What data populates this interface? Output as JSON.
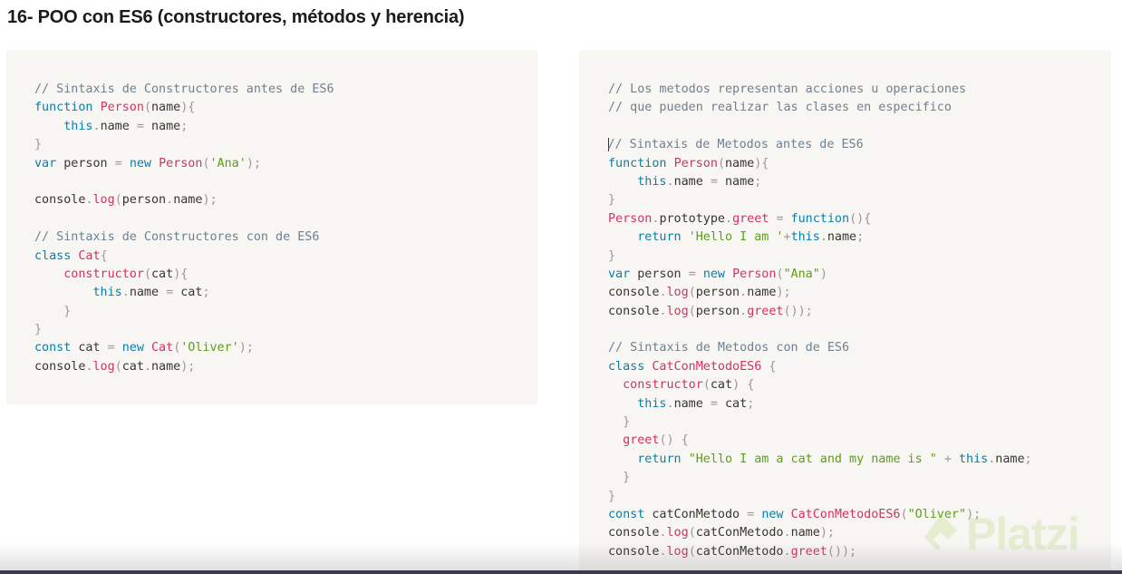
{
  "page": {
    "title": "16- POO con ES6 (constructores, métodos y herencia)"
  },
  "watermark": {
    "text": "Platzi"
  },
  "colors": {
    "panel_background": "#f7f6f3",
    "comment": "#708090",
    "keyword": "#0a7ea8",
    "function": "#d3325f",
    "string": "#5c9e17",
    "punctuation": "#999999",
    "watermark": "#98ca3f"
  },
  "code_blocks": [
    {
      "lines": [
        [
          [
            "comment",
            "// Sintaxis de Constructores antes de ES6"
          ]
        ],
        [
          [
            "keyword",
            "function"
          ],
          [
            "plain",
            " "
          ],
          [
            "function",
            "Person"
          ],
          [
            "punct",
            "("
          ],
          [
            "plain",
            "name"
          ],
          [
            "punct",
            "){"
          ]
        ],
        [
          [
            "plain",
            "    "
          ],
          [
            "keyword",
            "this"
          ],
          [
            "punct",
            "."
          ],
          [
            "plain",
            "name "
          ],
          [
            "punct",
            "="
          ],
          [
            "plain",
            " name"
          ],
          [
            "punct",
            ";"
          ]
        ],
        [
          [
            "punct",
            "}"
          ]
        ],
        [
          [
            "keyword",
            "var"
          ],
          [
            "plain",
            " person "
          ],
          [
            "punct",
            "="
          ],
          [
            "plain",
            " "
          ],
          [
            "keyword",
            "new"
          ],
          [
            "plain",
            " "
          ],
          [
            "function",
            "Person"
          ],
          [
            "punct",
            "("
          ],
          [
            "string",
            "'Ana'"
          ],
          [
            "punct",
            ");"
          ]
        ],
        [],
        [
          [
            "plain",
            "console"
          ],
          [
            "punct",
            "."
          ],
          [
            "function",
            "log"
          ],
          [
            "punct",
            "("
          ],
          [
            "plain",
            "person"
          ],
          [
            "punct",
            "."
          ],
          [
            "plain",
            "name"
          ],
          [
            "punct",
            ");"
          ]
        ],
        [],
        [
          [
            "comment",
            "// Sintaxis de Constructores con de ES6"
          ]
        ],
        [
          [
            "keyword",
            "class"
          ],
          [
            "plain",
            " "
          ],
          [
            "function",
            "Cat"
          ],
          [
            "punct",
            "{"
          ]
        ],
        [
          [
            "plain",
            "    "
          ],
          [
            "function",
            "constructor"
          ],
          [
            "punct",
            "("
          ],
          [
            "plain",
            "cat"
          ],
          [
            "punct",
            "){"
          ]
        ],
        [
          [
            "plain",
            "        "
          ],
          [
            "keyword",
            "this"
          ],
          [
            "punct",
            "."
          ],
          [
            "plain",
            "name "
          ],
          [
            "punct",
            "="
          ],
          [
            "plain",
            " cat"
          ],
          [
            "punct",
            ";"
          ]
        ],
        [
          [
            "plain",
            "    "
          ],
          [
            "punct",
            "}"
          ]
        ],
        [
          [
            "punct",
            "}"
          ]
        ],
        [
          [
            "keyword",
            "const"
          ],
          [
            "plain",
            " cat "
          ],
          [
            "punct",
            "="
          ],
          [
            "plain",
            " "
          ],
          [
            "keyword",
            "new"
          ],
          [
            "plain",
            " "
          ],
          [
            "function",
            "Cat"
          ],
          [
            "punct",
            "("
          ],
          [
            "string",
            "'Oliver'"
          ],
          [
            "punct",
            ");"
          ]
        ],
        [
          [
            "plain",
            "console"
          ],
          [
            "punct",
            "."
          ],
          [
            "function",
            "log"
          ],
          [
            "punct",
            "("
          ],
          [
            "plain",
            "cat"
          ],
          [
            "punct",
            "."
          ],
          [
            "plain",
            "name"
          ],
          [
            "punct",
            ");"
          ]
        ]
      ]
    },
    {
      "lines": [
        [
          [
            "comment",
            "// Los metodos representan acciones u operaciones"
          ]
        ],
        [
          [
            "comment",
            "// que pueden realizar las clases en especifico"
          ]
        ],
        [],
        [
          [
            "cursor",
            ""
          ],
          [
            "comment",
            "// Sintaxis de Metodos antes de ES6"
          ]
        ],
        [
          [
            "keyword",
            "function"
          ],
          [
            "plain",
            " "
          ],
          [
            "function",
            "Person"
          ],
          [
            "punct",
            "("
          ],
          [
            "plain",
            "name"
          ],
          [
            "punct",
            "){"
          ]
        ],
        [
          [
            "plain",
            "    "
          ],
          [
            "keyword",
            "this"
          ],
          [
            "punct",
            "."
          ],
          [
            "plain",
            "name "
          ],
          [
            "punct",
            "="
          ],
          [
            "plain",
            " name"
          ],
          [
            "punct",
            ";"
          ]
        ],
        [
          [
            "punct",
            "}"
          ]
        ],
        [
          [
            "function",
            "Person"
          ],
          [
            "punct",
            "."
          ],
          [
            "plain",
            "prototype"
          ],
          [
            "punct",
            "."
          ],
          [
            "function",
            "greet"
          ],
          [
            "plain",
            " "
          ],
          [
            "punct",
            "="
          ],
          [
            "plain",
            " "
          ],
          [
            "keyword",
            "function"
          ],
          [
            "punct",
            "(){"
          ]
        ],
        [
          [
            "plain",
            "    "
          ],
          [
            "keyword",
            "return"
          ],
          [
            "plain",
            " "
          ],
          [
            "string",
            "'Hello I am '"
          ],
          [
            "punct",
            "+"
          ],
          [
            "keyword",
            "this"
          ],
          [
            "punct",
            "."
          ],
          [
            "plain",
            "name"
          ],
          [
            "punct",
            ";"
          ]
        ],
        [
          [
            "punct",
            "}"
          ]
        ],
        [
          [
            "keyword",
            "var"
          ],
          [
            "plain",
            " person "
          ],
          [
            "punct",
            "="
          ],
          [
            "plain",
            " "
          ],
          [
            "keyword",
            "new"
          ],
          [
            "plain",
            " "
          ],
          [
            "function",
            "Person"
          ],
          [
            "punct",
            "("
          ],
          [
            "string",
            "\"Ana\""
          ],
          [
            "punct",
            ")"
          ]
        ],
        [
          [
            "plain",
            "console"
          ],
          [
            "punct",
            "."
          ],
          [
            "function",
            "log"
          ],
          [
            "punct",
            "("
          ],
          [
            "plain",
            "person"
          ],
          [
            "punct",
            "."
          ],
          [
            "plain",
            "name"
          ],
          [
            "punct",
            ");"
          ]
        ],
        [
          [
            "plain",
            "console"
          ],
          [
            "punct",
            "."
          ],
          [
            "function",
            "log"
          ],
          [
            "punct",
            "("
          ],
          [
            "plain",
            "person"
          ],
          [
            "punct",
            "."
          ],
          [
            "function",
            "greet"
          ],
          [
            "punct",
            "());"
          ]
        ],
        [],
        [
          [
            "comment",
            "// Sintaxis de Metodos con de ES6"
          ]
        ],
        [
          [
            "keyword",
            "class"
          ],
          [
            "plain",
            " "
          ],
          [
            "function",
            "CatConMetodoES6"
          ],
          [
            "plain",
            " "
          ],
          [
            "punct",
            "{"
          ]
        ],
        [
          [
            "plain",
            "  "
          ],
          [
            "function",
            "constructor"
          ],
          [
            "punct",
            "("
          ],
          [
            "plain",
            "cat"
          ],
          [
            "punct",
            ")"
          ],
          [
            "plain",
            " "
          ],
          [
            "punct",
            "{"
          ]
        ],
        [
          [
            "plain",
            "    "
          ],
          [
            "keyword",
            "this"
          ],
          [
            "punct",
            "."
          ],
          [
            "plain",
            "name "
          ],
          [
            "punct",
            "="
          ],
          [
            "plain",
            " cat"
          ],
          [
            "punct",
            ";"
          ]
        ],
        [
          [
            "plain",
            "  "
          ],
          [
            "punct",
            "}"
          ]
        ],
        [
          [
            "plain",
            "  "
          ],
          [
            "function",
            "greet"
          ],
          [
            "punct",
            "()"
          ],
          [
            "plain",
            " "
          ],
          [
            "punct",
            "{"
          ]
        ],
        [
          [
            "plain",
            "    "
          ],
          [
            "keyword",
            "return"
          ],
          [
            "plain",
            " "
          ],
          [
            "string",
            "\"Hello I am a cat and my name is \""
          ],
          [
            "plain",
            " "
          ],
          [
            "punct",
            "+"
          ],
          [
            "plain",
            " "
          ],
          [
            "keyword",
            "this"
          ],
          [
            "punct",
            "."
          ],
          [
            "plain",
            "name"
          ],
          [
            "punct",
            ";"
          ]
        ],
        [
          [
            "plain",
            "  "
          ],
          [
            "punct",
            "}"
          ]
        ],
        [
          [
            "punct",
            "}"
          ]
        ],
        [
          [
            "keyword",
            "const"
          ],
          [
            "plain",
            " catConMetodo "
          ],
          [
            "punct",
            "="
          ],
          [
            "plain",
            " "
          ],
          [
            "keyword",
            "new"
          ],
          [
            "plain",
            " "
          ],
          [
            "function",
            "CatConMetodoES6"
          ],
          [
            "punct",
            "("
          ],
          [
            "string",
            "\"Oliver\""
          ],
          [
            "punct",
            ");"
          ]
        ],
        [
          [
            "plain",
            "console"
          ],
          [
            "punct",
            "."
          ],
          [
            "function",
            "log"
          ],
          [
            "punct",
            "("
          ],
          [
            "plain",
            "catConMetodo"
          ],
          [
            "punct",
            "."
          ],
          [
            "plain",
            "name"
          ],
          [
            "punct",
            ");"
          ]
        ],
        [
          [
            "plain",
            "console"
          ],
          [
            "punct",
            "."
          ],
          [
            "function",
            "log"
          ],
          [
            "punct",
            "("
          ],
          [
            "plain",
            "catConMetodo"
          ],
          [
            "punct",
            "."
          ],
          [
            "function",
            "greet"
          ],
          [
            "punct",
            "());"
          ]
        ]
      ]
    }
  ]
}
